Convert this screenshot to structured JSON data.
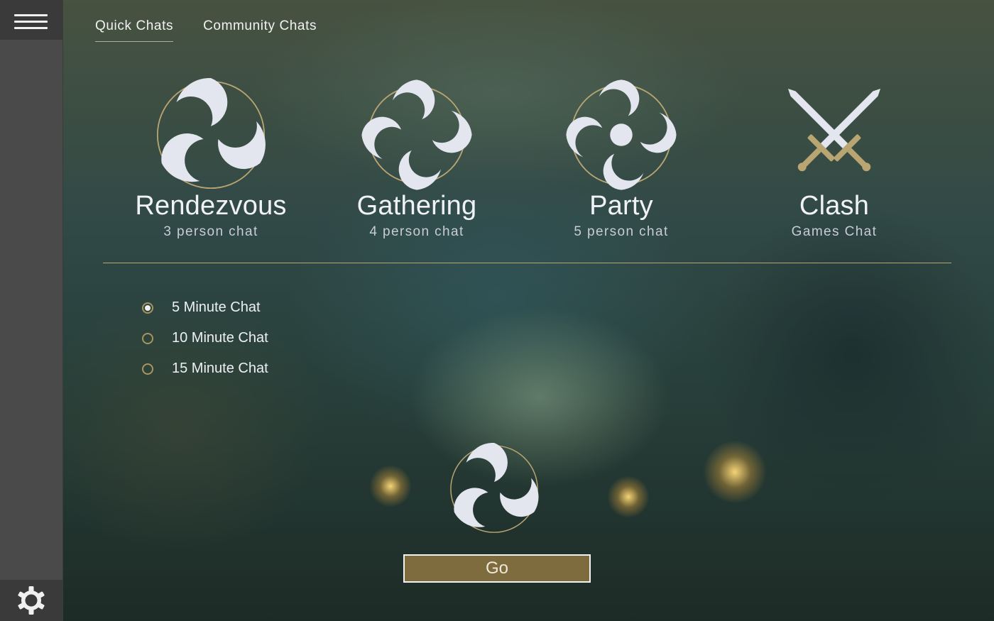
{
  "colors": {
    "accent_gold": "#b9a572",
    "button_fill": "#7e6c3e",
    "icon_fill": "#e3e6ee",
    "sidebar": "#4a4a4a"
  },
  "sidebar": {
    "menu_icon": "hamburger-icon",
    "settings_icon": "gear-icon"
  },
  "tabs": [
    {
      "label": "Quick Chats",
      "active": true
    },
    {
      "label": "Community Chats",
      "active": false
    }
  ],
  "chat_types": [
    {
      "name": "Rendezvous",
      "subtitle": "3 person chat",
      "icon": "three-swirl-icon"
    },
    {
      "name": "Gathering",
      "subtitle": "4 person chat",
      "icon": "four-swirl-icon"
    },
    {
      "name": "Party",
      "subtitle": "5 person chat",
      "icon": "five-swirl-icon"
    },
    {
      "name": "Clash",
      "subtitle": "Games Chat",
      "icon": "crossed-swords-icon"
    }
  ],
  "durations": [
    {
      "label": "5 Minute Chat",
      "selected": true
    },
    {
      "label": "10 Minute Chat",
      "selected": false
    },
    {
      "label": "15 Minute Chat",
      "selected": false
    }
  ],
  "preview_icon": "three-swirl-icon",
  "go_label": "Go"
}
